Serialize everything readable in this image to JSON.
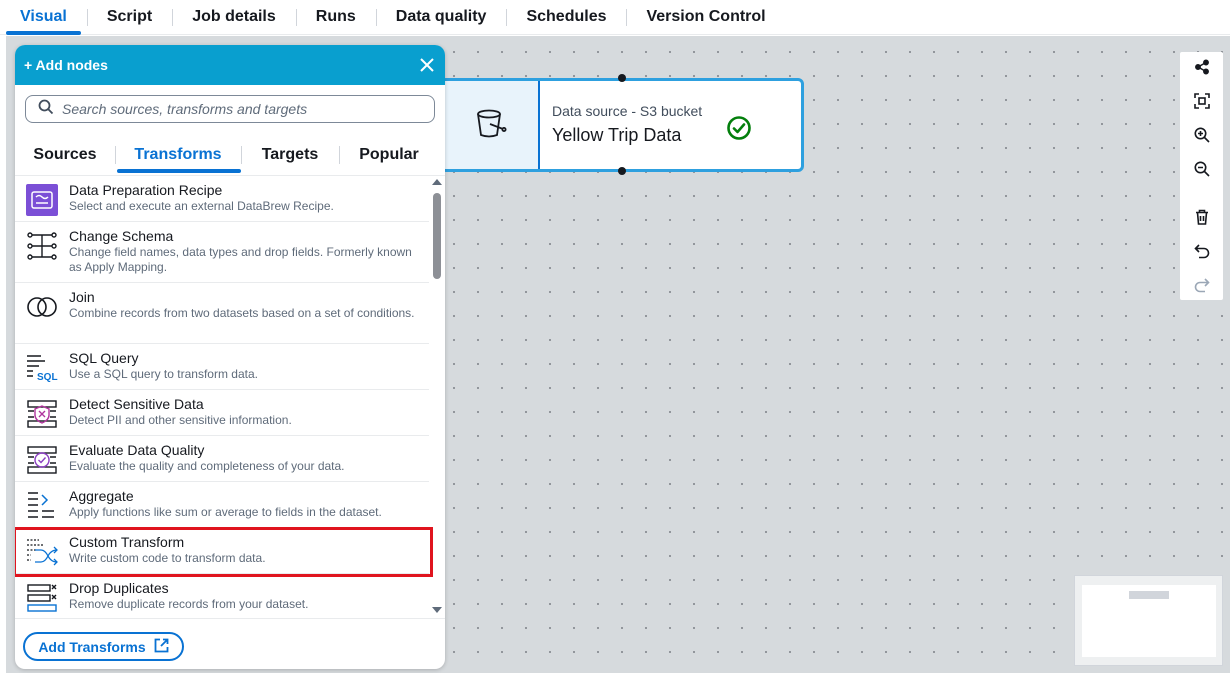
{
  "top_tabs": [
    {
      "label": "Visual",
      "active": true
    },
    {
      "label": "Script"
    },
    {
      "label": "Job details"
    },
    {
      "label": "Runs"
    },
    {
      "label": "Data quality"
    },
    {
      "label": "Schedules"
    },
    {
      "label": "Version Control"
    }
  ],
  "panel": {
    "title": "+ Add nodes",
    "search_placeholder": "Search sources, transforms and targets",
    "tabs": [
      {
        "label": "Sources"
      },
      {
        "label": "Transforms",
        "active": true
      },
      {
        "label": "Targets"
      },
      {
        "label": "Popular"
      }
    ],
    "items": [
      {
        "title": "Data Preparation Recipe",
        "desc": "Select and execute an external DataBrew Recipe.",
        "icon": "databrew-recipe-icon"
      },
      {
        "title": "Change Schema",
        "desc": "Change field names, data types and drop fields. Formerly known as Apply Mapping.",
        "icon": "change-schema-icon"
      },
      {
        "title": "Join",
        "desc": "Combine records from two datasets based on a set of conditions.",
        "icon": "join-icon"
      },
      {
        "title": "SQL Query",
        "desc": "Use a SQL query to transform data.",
        "icon": "sql-query-icon"
      },
      {
        "title": "Detect Sensitive Data",
        "desc": "Detect PII and other sensitive information.",
        "icon": "detect-sensitive-data-icon"
      },
      {
        "title": "Evaluate Data Quality",
        "desc": "Evaluate the quality and completeness of your data.",
        "icon": "evaluate-data-quality-icon"
      },
      {
        "title": "Aggregate",
        "desc": "Apply functions like sum or average to fields in the dataset.",
        "icon": "aggregate-icon"
      },
      {
        "title": "Custom Transform",
        "desc": "Write custom code to transform data.",
        "icon": "custom-transform-icon",
        "highlighted": true
      },
      {
        "title": "Drop Duplicates",
        "desc": "Remove duplicate records from your dataset.",
        "icon": "drop-duplicates-icon"
      }
    ],
    "footer_button": "Add Transforms"
  },
  "node": {
    "type_label": "Data source - S3 bucket",
    "name": "Yellow Trip Data",
    "icon": "s3-bucket-icon",
    "status_icon": "check-circle-icon"
  },
  "colors": {
    "accent": "#0972d3",
    "panel_header": "#099fcf",
    "highlight": "#e0141e",
    "success": "#037f0c"
  }
}
